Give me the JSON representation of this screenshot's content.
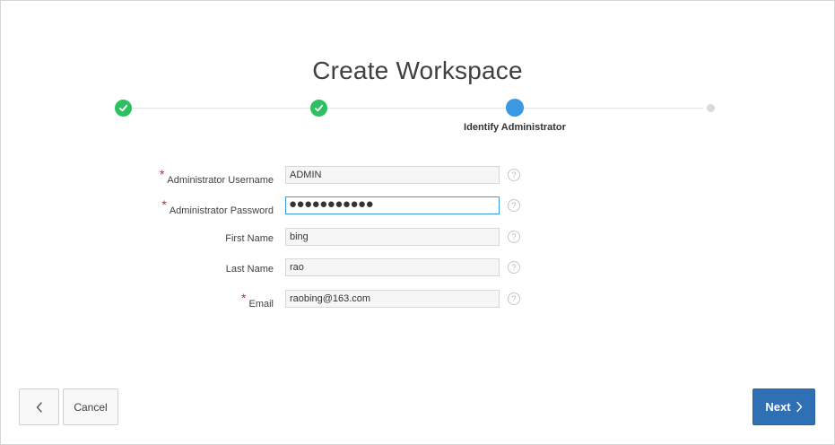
{
  "page": {
    "title": "Create Workspace"
  },
  "wizard": {
    "steps": [
      {
        "status": "complete",
        "icon": "check-icon"
      },
      {
        "status": "complete",
        "icon": "check-icon"
      },
      {
        "status": "current",
        "label": "Identify Administrator"
      },
      {
        "status": "upcoming"
      }
    ],
    "colors": {
      "complete": "#2ebf63",
      "current": "#3b98e3",
      "upcoming": "#dadada"
    }
  },
  "form": {
    "username": {
      "label": "Administrator Username",
      "value": "ADMIN",
      "required": true
    },
    "password": {
      "label": "Administrator Password",
      "masked": "●●●●●●●●●●●",
      "required": true
    },
    "first_name": {
      "label": "First Name",
      "value": "bing",
      "required": false
    },
    "last_name": {
      "label": "Last Name",
      "value": "rao",
      "required": false
    },
    "email": {
      "label": "Email",
      "value": "raobing@163.com",
      "required": true
    },
    "required_marker": "*",
    "help_glyph": "?"
  },
  "buttons": {
    "back_icon": "chevron-left-icon",
    "cancel_label": "Cancel",
    "next_label": "Next",
    "next_icon": "chevron-right-icon",
    "primary_color": "#2f6fb3"
  }
}
